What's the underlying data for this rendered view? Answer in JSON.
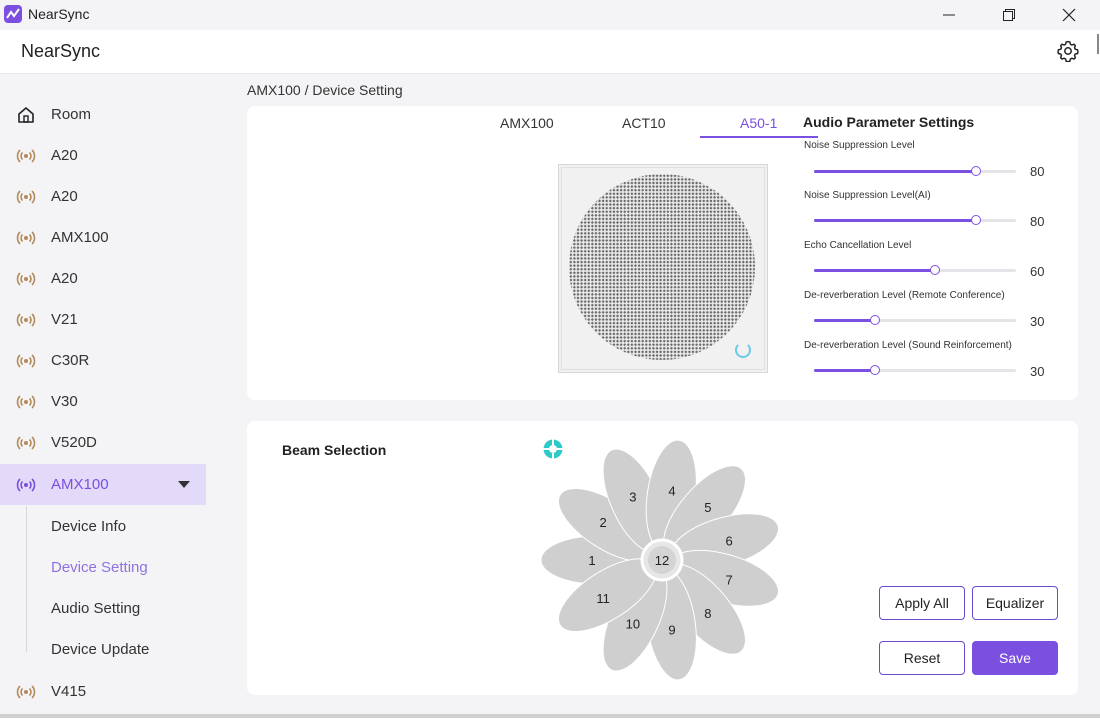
{
  "window": {
    "title": "NearSync",
    "controls": {
      "minimize": "minimize-icon",
      "maximize": "maximize-icon",
      "close": "close-icon"
    }
  },
  "header": {
    "title": "NearSync",
    "settings_icon": "gear-icon"
  },
  "sidebar": {
    "items": [
      {
        "label": "Room",
        "icon": "home-icon"
      },
      {
        "label": "A20",
        "icon": "broadcast-icon"
      },
      {
        "label": "A20",
        "icon": "broadcast-icon"
      },
      {
        "label": "AMX100",
        "icon": "broadcast-icon"
      },
      {
        "label": "A20",
        "icon": "broadcast-icon"
      },
      {
        "label": "V21",
        "icon": "broadcast-icon"
      },
      {
        "label": "C30R",
        "icon": "broadcast-icon"
      },
      {
        "label": "V30",
        "icon": "broadcast-icon"
      },
      {
        "label": "V520D",
        "icon": "broadcast-icon"
      },
      {
        "label": "AMX100",
        "icon": "broadcast-icon",
        "active": true,
        "expanded": true
      },
      {
        "label": "V415",
        "icon": "broadcast-icon"
      }
    ],
    "subitems": [
      {
        "label": "Device Info"
      },
      {
        "label": "Device Setting",
        "active": true
      },
      {
        "label": "Audio Setting"
      },
      {
        "label": "Device Update"
      }
    ]
  },
  "breadcrumb": "AMX100 / Device Setting",
  "device_tabs": [
    {
      "label": "AMX100"
    },
    {
      "label": "ACT10"
    },
    {
      "label": "A50-1",
      "active": true
    }
  ],
  "audio_params": {
    "title": "Audio Parameter Settings",
    "sliders": [
      {
        "label": "Noise Suppression Level",
        "value": "80",
        "fraction": 0.8
      },
      {
        "label": "Noise Suppression Level(AI)",
        "value": "80",
        "fraction": 0.8
      },
      {
        "label": "Echo Cancellation Level",
        "value": "60",
        "fraction": 0.6
      },
      {
        "label": "De-reverberation Level (Remote Conference)",
        "value": "30",
        "fraction": 0.3
      },
      {
        "label": "De-reverberation Level (Sound Reinforcement)",
        "value": "30",
        "fraction": 0.3
      }
    ]
  },
  "beam": {
    "title": "Beam Selection",
    "icon": "target-icon",
    "petals": [
      "1",
      "2",
      "3",
      "4",
      "5",
      "6",
      "7",
      "8",
      "9",
      "10",
      "11"
    ],
    "center": "12"
  },
  "buttons": {
    "apply_all": "Apply All",
    "equalizer": "Equalizer",
    "reset": "Reset",
    "save": "Save"
  },
  "colors": {
    "accent": "#7b4fe0",
    "active_bg": "#e3d9f8",
    "active_sub": "#8f72e0",
    "petal": "#cfcfcf",
    "target": "#2ec9c9"
  }
}
